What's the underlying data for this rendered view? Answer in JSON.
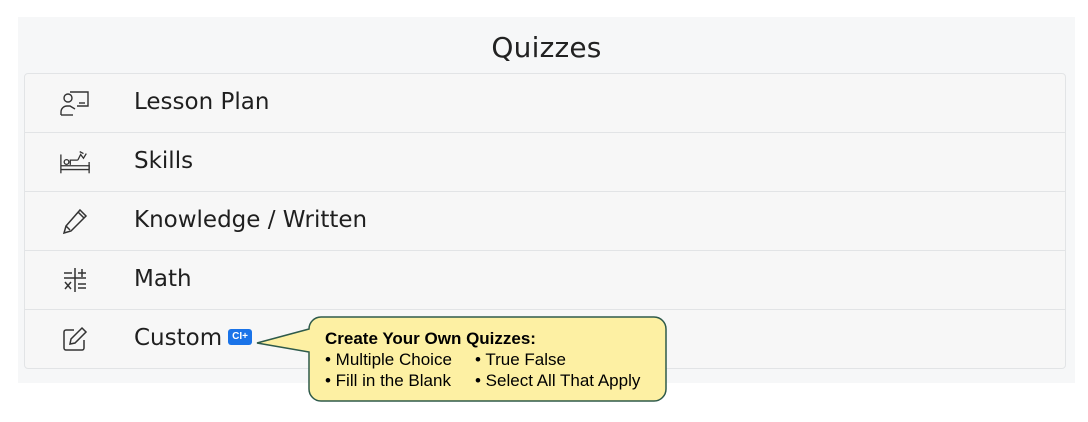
{
  "panel": {
    "title": "Quizzes"
  },
  "items": [
    {
      "label": "Lesson Plan",
      "icon": "teacher-board-icon"
    },
    {
      "label": "Skills",
      "icon": "skills-bed-icon"
    },
    {
      "label": "Knowledge / Written",
      "icon": "pencil-icon"
    },
    {
      "label": "Math",
      "icon": "math-operators-icon"
    },
    {
      "label": "Custom",
      "icon": "edit-square-icon",
      "badge": "CI+"
    }
  ],
  "callout": {
    "heading": "Create Your Own Quizzes:",
    "bullets": [
      [
        "• Multiple Choice",
        "• True False"
      ],
      [
        "• Fill in the Blank",
        "• Select All That Apply"
      ]
    ]
  },
  "colors": {
    "panel_bg": "#f6f7f8",
    "badge_bg": "#1a73e8",
    "callout_bg": "#fdf0a3",
    "callout_border": "#2e5a4a"
  }
}
